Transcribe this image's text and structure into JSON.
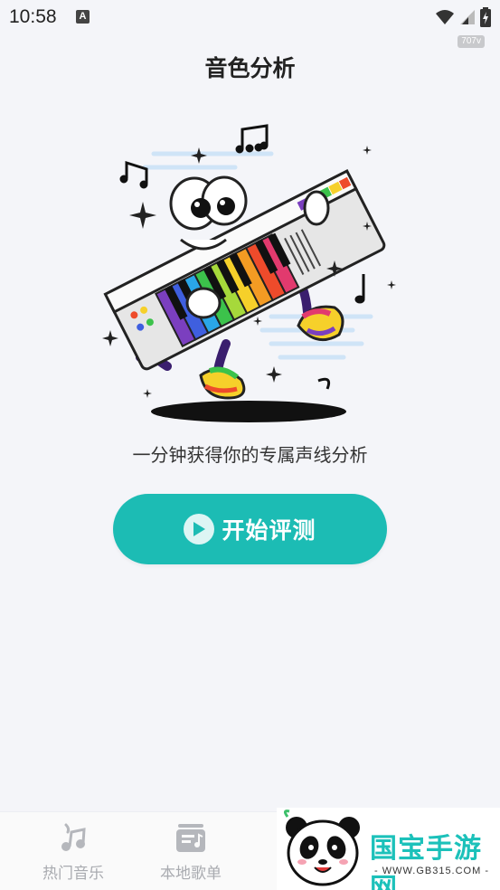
{
  "status_bar": {
    "time": "10:58",
    "notification_icon_letter": "A",
    "network_speed": "707v"
  },
  "page": {
    "title": "音色分析",
    "tagline": "一分钟获得你的专属声线分析",
    "start_button_label": "开始评测"
  },
  "tabs": [
    {
      "label": "热门音乐",
      "icon": "music-note-icon"
    },
    {
      "label": "本地歌单",
      "icon": "playlist-icon"
    }
  ],
  "watermark": {
    "brand": "国宝手游网",
    "url": "- WWW.GB315.COM -"
  },
  "colors": {
    "accent": "#1cbcb4",
    "background": "#f4f5f9",
    "tab_inactive": "#a9abb0"
  }
}
